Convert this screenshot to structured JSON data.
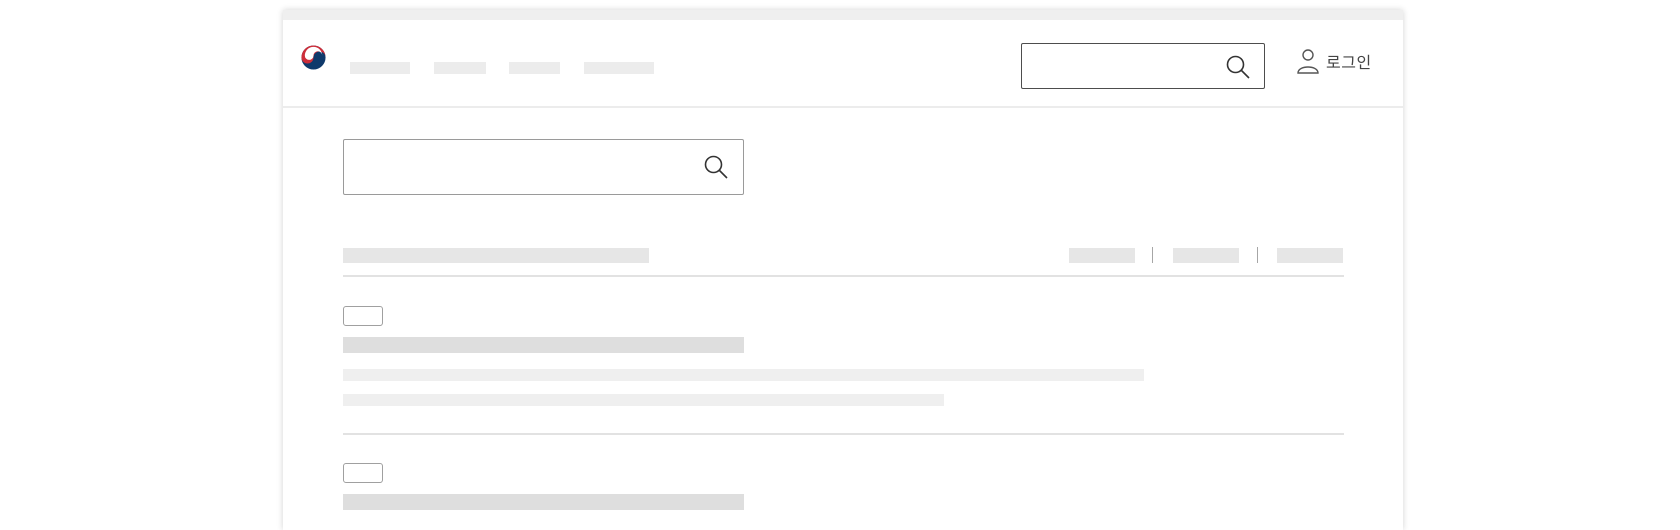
{
  "header": {
    "login_label": "로그인",
    "nav_placeholders": 4
  },
  "icons": {
    "logo": "government-emblem-icon",
    "header_search": "search-icon",
    "main_search": "search-icon",
    "login": "user-icon"
  },
  "sort_options": 3,
  "results": [
    {
      "badge": "",
      "title": "",
      "lines": 2
    },
    {
      "badge": "",
      "title": "",
      "lines": 2
    }
  ],
  "colors": {
    "placeholder": "#e6e6e6",
    "border_dark": "#4d4d4d",
    "emblem_red": "#cd2e3a",
    "emblem_blue": "#0f3a6b"
  }
}
